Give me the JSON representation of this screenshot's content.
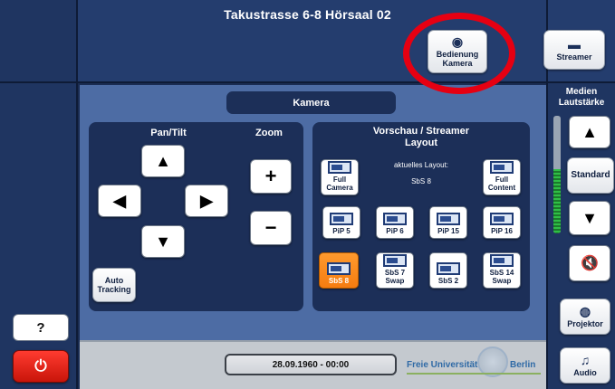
{
  "header": {
    "title": "Takustrasse 6-8 Hörsaal 02"
  },
  "top_buttons": {
    "bedienung_kamera": "Bedienung\nKamera",
    "streamer": "Streamer"
  },
  "camera": {
    "title": "Kamera",
    "pan_tilt_label": "Pan/Tilt",
    "zoom_label": "Zoom",
    "zoom_plus": "+",
    "zoom_minus": "−",
    "auto_tracking": "Auto\nTracking"
  },
  "preview": {
    "title": "Vorschau / Streamer\nLayout",
    "current_layout_label": "aktuelles Layout:",
    "current_layout_value": "SbS 8",
    "full_camera": "Full\nCamera",
    "full_content": "Full\nContent",
    "layouts": [
      "PiP 5",
      "PiP 6",
      "PiP 15",
      "PiP 16",
      "SbS 8",
      "SbS 7\nSwap",
      "SbS 2",
      "SbS 14\nSwap"
    ],
    "active_layout": "SbS 8"
  },
  "media": {
    "title": "Medien\nLautstärke",
    "standard": "Standard",
    "projector": "Projektor",
    "audio": "Audio",
    "volume_level": 0.55
  },
  "footer": {
    "datetime": "28.09.1960  -  00:00",
    "fu_left": "Freie Universität",
    "fu_right": "Berlin"
  },
  "left_panel": {
    "help": "?",
    "power_icon": "⏻"
  },
  "icons": [
    "camera-icon",
    "monitor-icon",
    "arrow-up-icon",
    "arrow-down-icon",
    "arrow-left-icon",
    "arrow-right-icon",
    "mute-icon",
    "projector-icon",
    "audio-icon",
    "power-icon"
  ],
  "colors": {
    "accent_orange": "#f57c10",
    "highlight_red": "#e60012",
    "power_red": "#e0251a"
  }
}
